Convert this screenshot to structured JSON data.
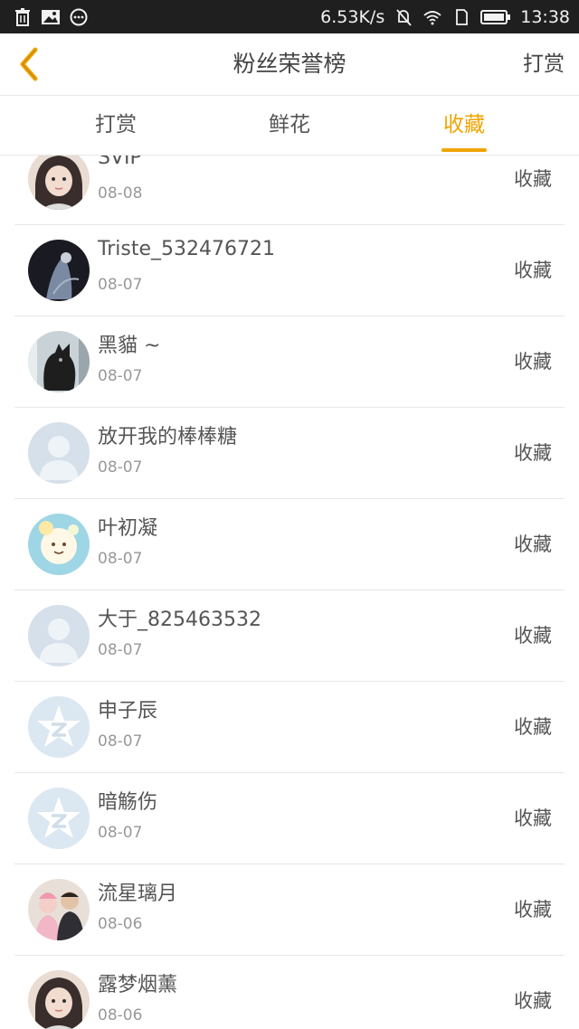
{
  "status_bar": {
    "speed": "6.53K/s",
    "time": "13:38"
  },
  "header": {
    "title": "粉丝荣誉榜",
    "action": "打赏"
  },
  "tabs": [
    {
      "label": "打赏",
      "active": false
    },
    {
      "label": "鲜花",
      "active": false
    },
    {
      "label": "收藏",
      "active": true
    }
  ],
  "colors": {
    "accent": "#f0a400",
    "status_bar_bg": "#1f1f1f"
  },
  "list": [
    {
      "name": "SVIP",
      "date": "08-08",
      "action": "收藏",
      "avatar": "photo-girl"
    },
    {
      "name": "Triste_532476721",
      "date": "08-07",
      "action": "收藏",
      "avatar": "photo-dark"
    },
    {
      "name": "黑貓 ~",
      "date": "08-07",
      "action": "收藏",
      "avatar": "photo-cat"
    },
    {
      "name": "放开我的棒棒糖",
      "date": "08-07",
      "action": "收藏",
      "avatar": "default-person"
    },
    {
      "name": "叶初凝",
      "date": "08-07",
      "action": "收藏",
      "avatar": "photo-cartoon"
    },
    {
      "name": "大于_825463532",
      "date": "08-07",
      "action": "收藏",
      "avatar": "default-person"
    },
    {
      "name": "申子辰",
      "date": "08-07",
      "action": "收藏",
      "avatar": "qzone-star"
    },
    {
      "name": "暗觞伤",
      "date": "08-07",
      "action": "收藏",
      "avatar": "qzone-star"
    },
    {
      "name": "流星璃月",
      "date": "08-06",
      "action": "收藏",
      "avatar": "photo-couple"
    },
    {
      "name": "露梦烟薰",
      "date": "08-06",
      "action": "收藏",
      "avatar": "photo-girl"
    }
  ]
}
